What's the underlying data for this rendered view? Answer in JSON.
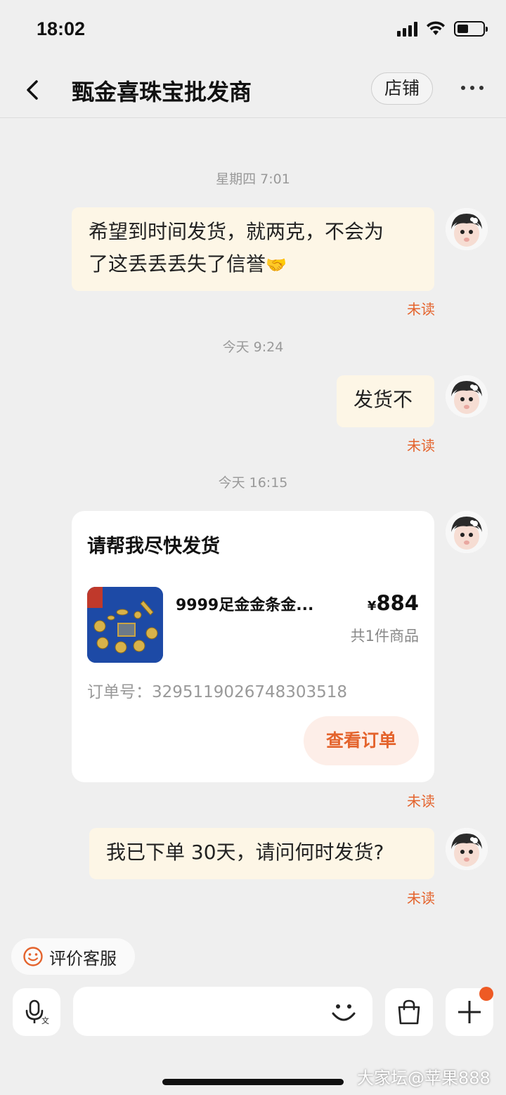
{
  "status_bar": {
    "time": "18:02"
  },
  "header": {
    "title": "甄金喜珠宝批发商",
    "shop_label": "店铺"
  },
  "messages": [
    {
      "time": "星期四 7:01",
      "text_line1": "希望到时间发货，就两克，不会为",
      "text_line2": "了这丢丢丢失了信誉",
      "emoji": "🤝",
      "status": "未读"
    },
    {
      "time": "今天 9:24",
      "text": "发货不",
      "status": "未读"
    },
    {
      "time": "今天 16:15",
      "status": "未读"
    },
    {
      "text": "我已下单 30天，请问何时发货?",
      "status": "未读"
    }
  ],
  "order_card": {
    "title": "请帮我尽快发货",
    "product_name": "9999足金金条金...",
    "currency": "¥",
    "price": "884",
    "item_count": "共1件商品",
    "order_no": "订单号：3295119026748303518",
    "view_label": "查看订单"
  },
  "footer": {
    "rate_label": "评价客服",
    "input_placeholder": ""
  },
  "watermark": "大家坛@苹果888",
  "colors": {
    "accent": "#e4632c",
    "bubble": "#fdf6e6",
    "background": "#efefef"
  }
}
